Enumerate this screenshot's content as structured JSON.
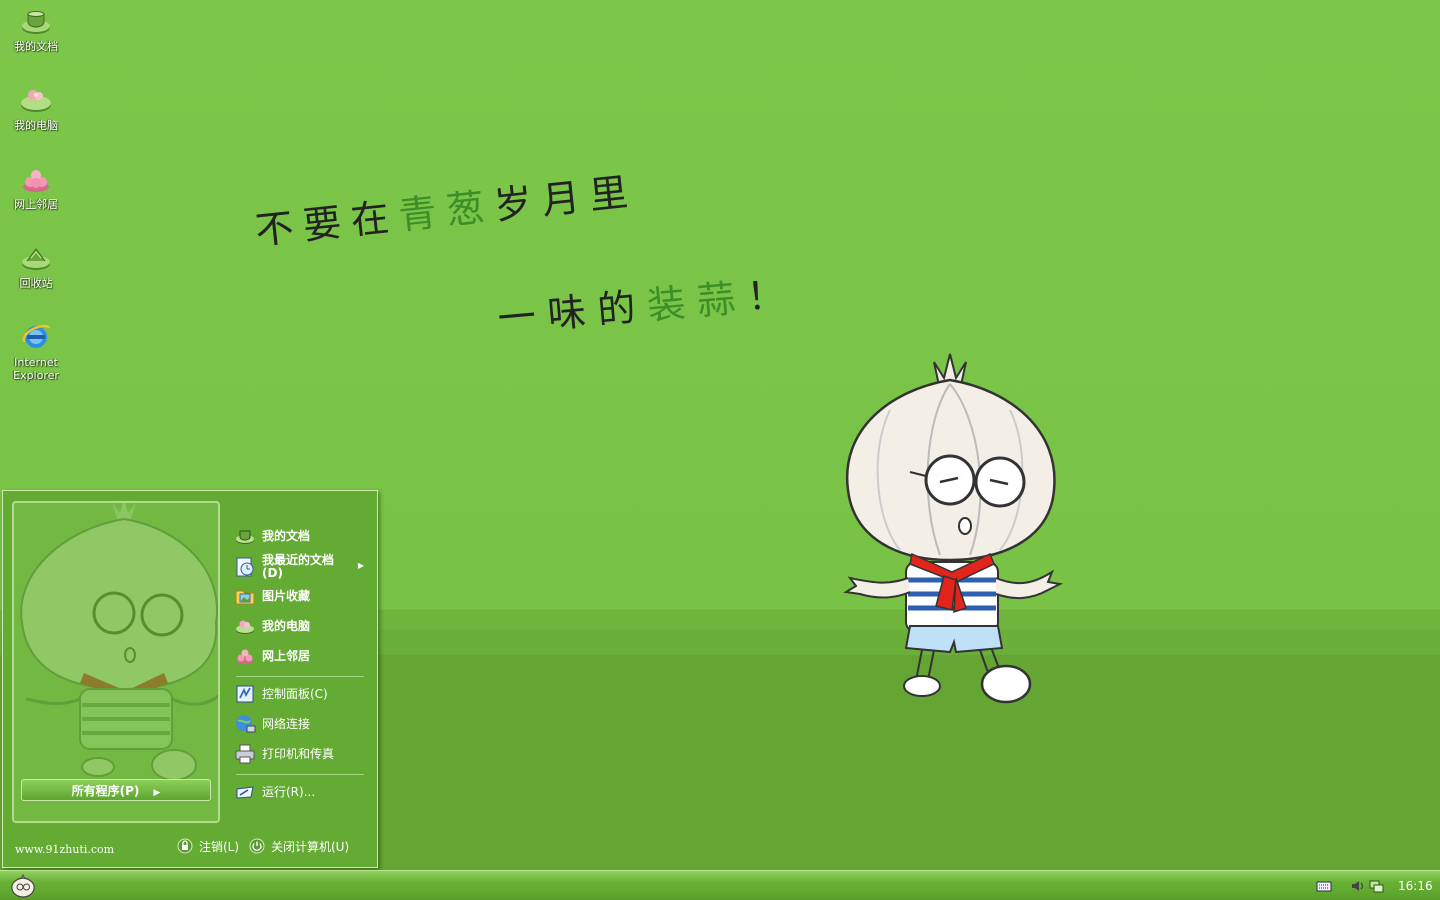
{
  "desktop": {
    "icons": [
      {
        "label": "我的文档",
        "icon": "my-documents-icon"
      },
      {
        "label": "我的电脑",
        "icon": "my-computer-icon"
      },
      {
        "label": "网上邻居",
        "icon": "network-places-icon"
      },
      {
        "label": "回收站",
        "icon": "recycle-bin-icon"
      },
      {
        "label": "Internet Explorer",
        "icon": "internet-explorer-icon"
      }
    ],
    "slogan": {
      "line1_a": "不要在",
      "line1_hl": "青葱",
      "line1_b": "岁月里",
      "line2_a": "一味的",
      "line2_hl": "装蒜",
      "line2_b": "！"
    },
    "background_color": "#7cc649"
  },
  "start_menu": {
    "all_programs": "所有程序(P)",
    "items": [
      {
        "label": "我的文档",
        "icon": "my-documents-icon",
        "bold": true
      },
      {
        "label": "我最近的文档(D)",
        "icon": "recent-documents-icon",
        "bold": true,
        "submenu": true
      },
      {
        "label": "图片收藏",
        "icon": "my-pictures-icon",
        "bold": true
      },
      {
        "label": "我的电脑",
        "icon": "my-computer-icon",
        "bold": true
      },
      {
        "label": "网上邻居",
        "icon": "network-places-icon",
        "bold": true
      },
      {
        "label": "控制面板(C)",
        "icon": "control-panel-icon",
        "bold": false
      },
      {
        "label": "网络连接",
        "icon": "network-connections-icon",
        "bold": false
      },
      {
        "label": "打印机和传真",
        "icon": "printers-faxes-icon",
        "bold": false
      },
      {
        "label": "运行(R)...",
        "icon": "run-icon",
        "bold": false
      }
    ],
    "footer": {
      "site": "www.91zhuti.com",
      "logoff": "注销(L)",
      "shutdown": "关闭计算机(U)"
    }
  },
  "taskbar": {
    "clock": "16:16",
    "tray_icons": [
      "keyboard-icon",
      "volume-icon",
      "network-status-icon"
    ]
  }
}
